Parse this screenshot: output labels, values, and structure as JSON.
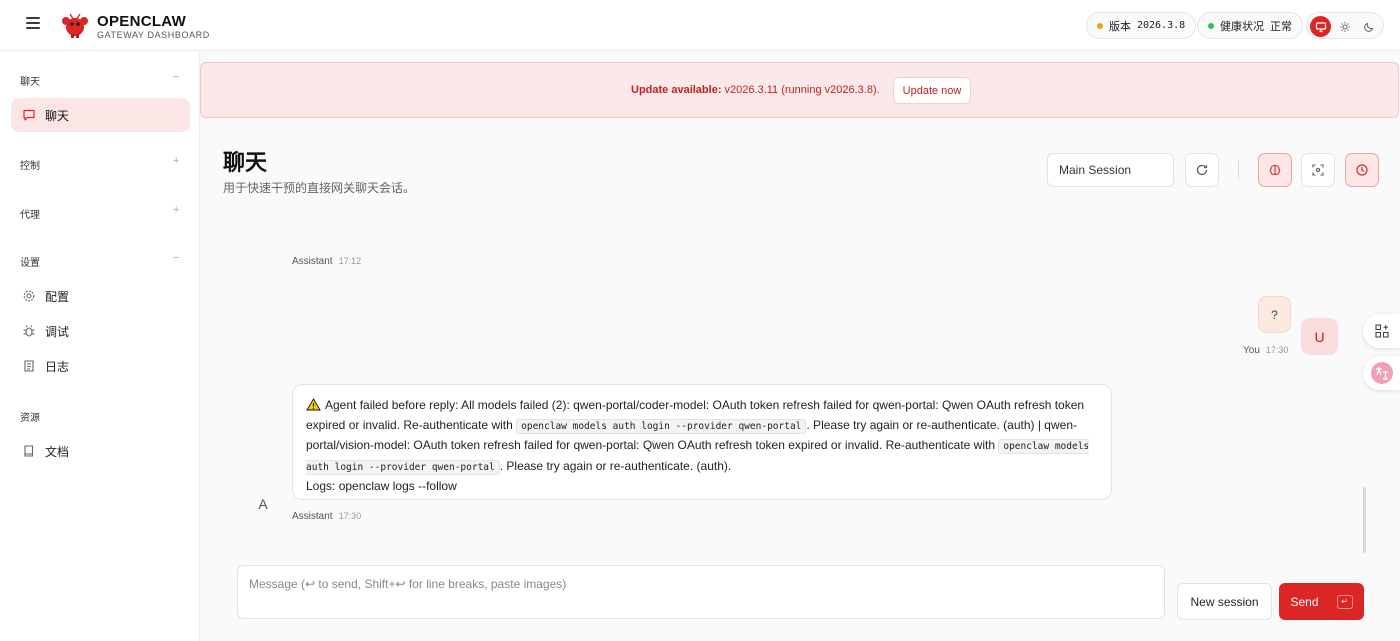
{
  "brand": {
    "title": "OPENCLAW",
    "subtitle": "GATEWAY DASHBOARD"
  },
  "status": {
    "version_label": "版本",
    "version_value": "2026.3.8",
    "version_dot_color": "#f59e0b",
    "health_label": "健康状况",
    "health_value": "正常",
    "health_dot_color": "#22c55e"
  },
  "theme": {
    "options": [
      "monitor-icon",
      "sun-icon",
      "moon-icon"
    ],
    "active": "monitor-icon",
    "accent": "#dc2626"
  },
  "sidebar": {
    "sections": [
      {
        "label": "聊天",
        "toggle": "−"
      },
      {
        "label": "控制",
        "toggle": "+"
      },
      {
        "label": "代理",
        "toggle": "+"
      },
      {
        "label": "设置",
        "toggle": "−"
      },
      {
        "label": "资源"
      }
    ],
    "items": [
      {
        "label": "聊天",
        "icon": "chat-icon",
        "active": true
      },
      {
        "label": "配置",
        "icon": "gear-icon"
      },
      {
        "label": "调试",
        "icon": "bug-icon"
      },
      {
        "label": "日志",
        "icon": "scroll-icon"
      },
      {
        "label": "文档",
        "icon": "book-icon"
      }
    ]
  },
  "banner": {
    "prefix": "Update available:",
    "message": "v2026.3.11 (running v2026.3.8).",
    "button": "Update now"
  },
  "header": {
    "title": "聊天",
    "subtitle": "用于快速干预的直接网关聊天会话。",
    "session": "Main Session"
  },
  "messages": [
    {
      "role": "Assistant",
      "time": "17:12"
    },
    {
      "role": "You",
      "time": "17:30",
      "text": "?",
      "avatar": "U"
    },
    {
      "role": "Assistant",
      "time": "17:30",
      "avatar": "A",
      "parts": {
        "p1": "Agent failed before reply: All models failed (2): qwen-portal/coder-model: OAuth token refresh failed for qwen-portal: Qwen OAuth refresh token expired or invalid. Re-authenticate with ",
        "code1": "openclaw models auth login --provider qwen-portal",
        "p2": ". Please try again or re-authenticate. (auth) | qwen-portal/vision-model: OAuth token refresh failed for qwen-portal: Qwen OAuth refresh token expired or invalid. Re-authenticate with ",
        "code2": "openclaw models auth login --provider qwen-portal",
        "p3": ". Please try again or re-authenticate. (auth).",
        "logs": "Logs: openclaw logs --follow"
      }
    }
  ],
  "composer": {
    "placeholder": "Message (↩ to send, Shift+↩ for line breaks, paste images)",
    "new_session": "New session",
    "send": "Send",
    "send_kbd": "↵"
  }
}
